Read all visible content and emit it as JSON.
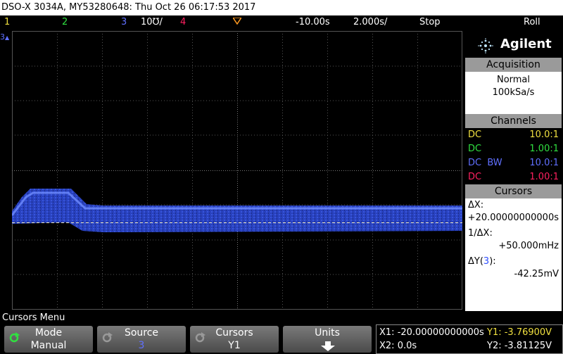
{
  "title_bar": "DSO-X 3034A, MY53280648: Thu Oct 26 06:17:53 2017",
  "status": {
    "ch1": "1",
    "ch2": "2",
    "ch3": "3",
    "ch3_scale": "10℧/",
    "ch4": "4",
    "time_offset": "-10.00s",
    "time_scale": "2.000s/",
    "run_state": "Stop",
    "mode": "Roll"
  },
  "marker": "3",
  "brand": "Agilent",
  "acquisition": {
    "header": "Acquisition",
    "mode": "Normal",
    "rate": "100kSa/s"
  },
  "channels": {
    "header": "Channels",
    "rows": [
      {
        "coupling": "DC",
        "probe": "10.0:1",
        "color": "#f0e040"
      },
      {
        "coupling": "DC",
        "probe": "1.00:1",
        "color": "#30e040"
      },
      {
        "coupling": "DC  BW",
        "probe": "10.0:1",
        "color": "#6070ff"
      },
      {
        "coupling": "DC",
        "probe": "1.00:1",
        "color": "#ff2060"
      }
    ]
  },
  "cursors": {
    "header": "Cursors",
    "dx_label": "ΔX:",
    "dx_value": "+20.00000000000s",
    "inv_dx_label": "1/ΔX:",
    "inv_dx_value": "+50.000mHz",
    "dy_label_pre": "ΔY(",
    "dy_channel": "3",
    "dy_label_post": "):",
    "dy_value": "-42.25mV"
  },
  "menu_title": "Cursors Menu",
  "softkeys": [
    {
      "title": "Mode",
      "value": "Manual"
    },
    {
      "title": "Source",
      "value": "3"
    },
    {
      "title": "Cursors",
      "value": "Y1"
    },
    {
      "title": "Units",
      "value": ""
    }
  ],
  "readout": {
    "x1": "X1: -20.00000000000s",
    "x2": "X2: 0.0s",
    "y1": "Y1: -3.76900V",
    "y2": "Y2: -3.81125V"
  },
  "colors": {
    "ch1": "#f0e040",
    "ch2": "#30e040",
    "ch3": "#6070ff",
    "ch4": "#ff2060",
    "trace": "#4a6ff0",
    "trigger": "#ff9a20"
  }
}
